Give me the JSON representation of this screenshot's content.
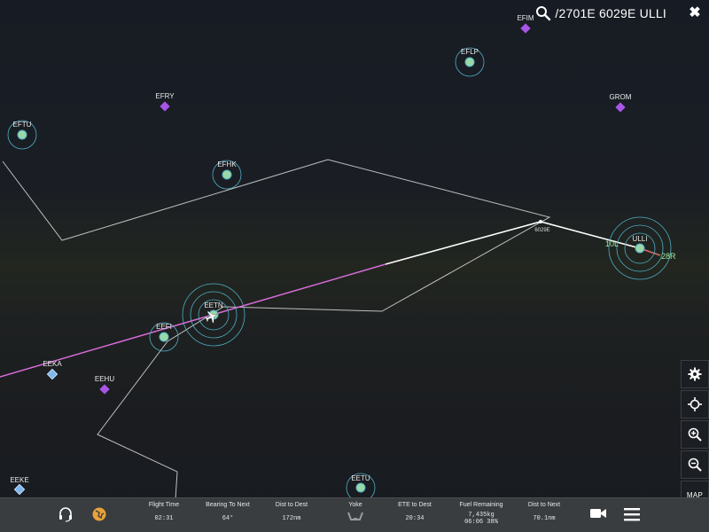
{
  "search": {
    "query": "/2701E 6029E ULLI"
  },
  "airports": [
    {
      "id": "EFIM",
      "kind": "intersection"
    },
    {
      "id": "EFLP",
      "kind": "airport"
    },
    {
      "id": "EFRY",
      "kind": "intersection"
    },
    {
      "id": "GROM",
      "kind": "intersection"
    },
    {
      "id": "EFTU",
      "kind": "airport"
    },
    {
      "id": "EFHK",
      "kind": "airport"
    },
    {
      "id": "ULLI",
      "kind": "airport-destination",
      "runways": [
        "10L",
        "28R"
      ]
    },
    {
      "id": "EETN",
      "kind": "airport-origin"
    },
    {
      "id": "EEFI",
      "kind": "airport"
    },
    {
      "id": "EEKA",
      "kind": "vor"
    },
    {
      "id": "EEHU",
      "kind": "intersection"
    },
    {
      "id": "EEKE",
      "kind": "vor"
    },
    {
      "id": "EETU",
      "kind": "airport"
    }
  ],
  "waypoints": [
    {
      "id": "6029E"
    }
  ],
  "colors": {
    "route": "#ffffff",
    "flown": "#d86bd8",
    "airport": "#4fb0c6",
    "intersection": "#a855e6",
    "vor": "#7fb8f0"
  },
  "controls": {
    "settings_icon": "gear-icon",
    "center_icon": "crosshair-icon",
    "zoom_in_icon": "zoom-in-icon",
    "zoom_out_icon": "zoom-out-icon",
    "map_label": "MAP"
  },
  "bottom": {
    "stats": [
      {
        "title": "Flight Time",
        "value": "02:31"
      },
      {
        "title": "Bearing To Next",
        "value": "64°"
      },
      {
        "title": "Dist to Dest",
        "value": "172nm"
      },
      {
        "title": "Yoke",
        "value": ""
      },
      {
        "title": "ETE to Dest",
        "value": "20:34"
      },
      {
        "title": "Fuel Remaining",
        "value": "7,435kg",
        "value2": "06:06 38%"
      },
      {
        "title": "Dist to Next",
        "value": "70.1nm"
      }
    ],
    "icons": [
      "headset-icon",
      "globe-icon",
      "camera-icon",
      "menu-icon"
    ]
  }
}
